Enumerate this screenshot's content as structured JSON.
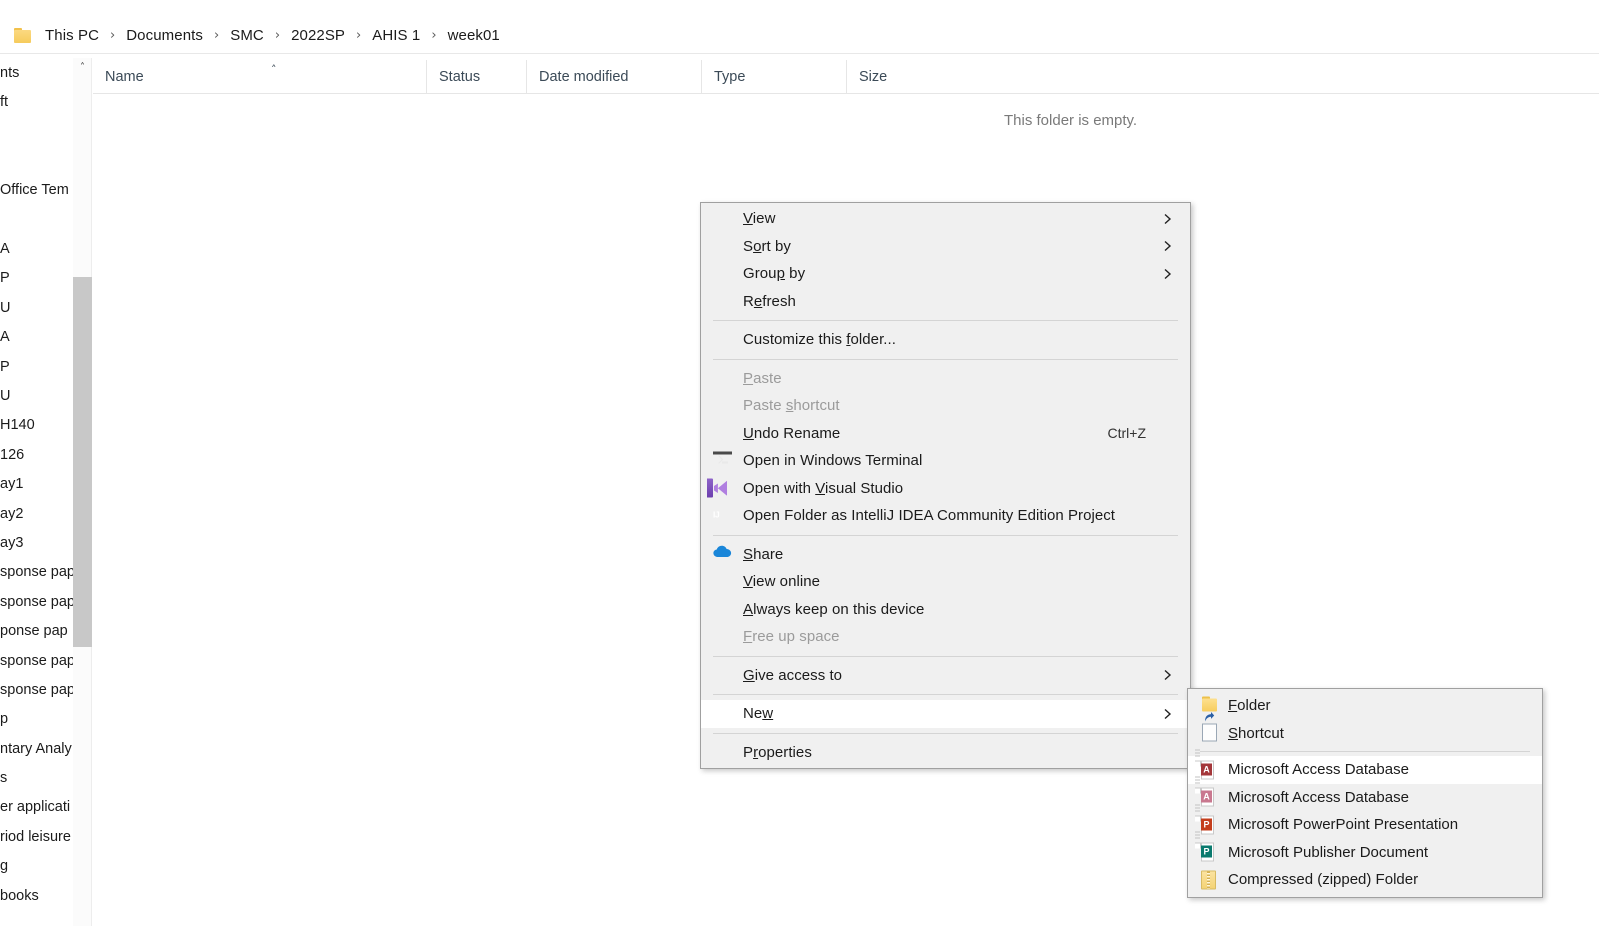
{
  "breadcrumb": {
    "folder_icon": "folder-icon",
    "separator": "›",
    "items": [
      {
        "label": "This PC"
      },
      {
        "label": "Documents"
      },
      {
        "label": "SMC"
      },
      {
        "label": "2022SP"
      },
      {
        "label": "AHIS 1"
      },
      {
        "label": "week01"
      }
    ]
  },
  "file_list": {
    "columns": [
      {
        "label": "Name"
      },
      {
        "label": "Status"
      },
      {
        "label": "Date modified"
      },
      {
        "label": "Type"
      },
      {
        "label": "Size"
      }
    ],
    "sort_caret": "˄",
    "empty_message": "This folder is empty."
  },
  "nav_pane": {
    "scroll_up_arrow": "˄",
    "items": [
      {
        "label": "nts"
      },
      {
        "label": "ft"
      },
      {
        "label": ""
      },
      {
        "label": ""
      },
      {
        "label": "Office Tem"
      },
      {
        "label": ""
      },
      {
        "label": "A"
      },
      {
        "label": "P"
      },
      {
        "label": "U"
      },
      {
        "label": "A"
      },
      {
        "label": "P"
      },
      {
        "label": "U"
      },
      {
        "label": "H140"
      },
      {
        "label": "126"
      },
      {
        "label": "ay1"
      },
      {
        "label": "ay2"
      },
      {
        "label": "ay3"
      },
      {
        "label": "sponse pap"
      },
      {
        "label": "sponse pap"
      },
      {
        "label": "ponse pap"
      },
      {
        "label": "sponse pap"
      },
      {
        "label": "sponse pap"
      },
      {
        "label": "p"
      },
      {
        "label": "ntary Analy"
      },
      {
        "label": "s"
      },
      {
        "label": "er applicati"
      },
      {
        "label": "riod leisure"
      },
      {
        "label": "g"
      },
      {
        "label": "books"
      }
    ]
  },
  "context_menu": {
    "items": [
      {
        "id": "view",
        "label": "View",
        "accel": "V",
        "accel_index": 0,
        "submenu": true,
        "icon": null,
        "shortcut": "",
        "disabled": false,
        "highlighted": false
      },
      {
        "id": "sort-by",
        "label": "Sort by",
        "accel": "o",
        "accel_index": 1,
        "submenu": true,
        "icon": null,
        "shortcut": "",
        "disabled": false,
        "highlighted": false
      },
      {
        "id": "group-by",
        "label": "Group by",
        "accel": "p",
        "accel_index": 4,
        "submenu": true,
        "icon": null,
        "shortcut": "",
        "disabled": false,
        "highlighted": false
      },
      {
        "id": "refresh",
        "label": "Refresh",
        "accel": "e",
        "accel_index": 1,
        "submenu": false,
        "icon": null,
        "shortcut": "",
        "disabled": false,
        "highlighted": false
      },
      {
        "id": "separator-1",
        "separator": true
      },
      {
        "id": "customize-this-folder",
        "label": "Customize this folder...",
        "accel": "f",
        "accel_index": 15,
        "submenu": false,
        "icon": null,
        "shortcut": "",
        "disabled": false,
        "highlighted": false
      },
      {
        "id": "separator-2",
        "separator": true
      },
      {
        "id": "paste",
        "label": "Paste",
        "accel": "P",
        "accel_index": 0,
        "submenu": false,
        "icon": null,
        "shortcut": "",
        "disabled": true,
        "highlighted": false
      },
      {
        "id": "paste-shortcut",
        "label": "Paste shortcut",
        "accel": "s",
        "accel_index": 6,
        "submenu": false,
        "icon": null,
        "shortcut": "",
        "disabled": true,
        "highlighted": false
      },
      {
        "id": "undo-rename",
        "label": "Undo Rename",
        "accel": "U",
        "accel_index": 0,
        "submenu": false,
        "icon": null,
        "shortcut": "Ctrl+Z",
        "disabled": false,
        "highlighted": false
      },
      {
        "id": "open-in-windows-terminal",
        "label": "Open in Windows Terminal",
        "accel": "",
        "accel_index": -1,
        "submenu": false,
        "icon": "terminal-icon",
        "shortcut": "",
        "disabled": false,
        "highlighted": false
      },
      {
        "id": "open-with-visual-studio",
        "label": "Open with Visual Studio",
        "accel": "V",
        "accel_index": 10,
        "submenu": false,
        "icon": "visual-studio-icon",
        "shortcut": "",
        "disabled": false,
        "highlighted": false
      },
      {
        "id": "open-folder-as-intellij-idea-community-edition-project",
        "label": "Open Folder as IntelliJ IDEA Community Edition Project",
        "accel": "",
        "accel_index": -1,
        "submenu": false,
        "icon": "intellij-idea-icon",
        "shortcut": "",
        "disabled": false,
        "highlighted": false
      },
      {
        "id": "separator-3",
        "separator": true
      },
      {
        "id": "share",
        "label": "Share",
        "accel": "S",
        "accel_index": 0,
        "submenu": false,
        "icon": "onedrive-cloud-icon",
        "shortcut": "",
        "disabled": false,
        "highlighted": false
      },
      {
        "id": "view-online",
        "label": "View online",
        "accel": "V",
        "accel_index": 0,
        "submenu": false,
        "icon": null,
        "shortcut": "",
        "disabled": false,
        "highlighted": false
      },
      {
        "id": "always-keep-on-this-device",
        "label": "Always keep on this device",
        "accel": "A",
        "accel_index": 0,
        "submenu": false,
        "icon": null,
        "shortcut": "",
        "disabled": false,
        "highlighted": false
      },
      {
        "id": "free-up-space",
        "label": "Free up space",
        "accel": "F",
        "accel_index": 0,
        "submenu": false,
        "icon": null,
        "shortcut": "",
        "disabled": true,
        "highlighted": false
      },
      {
        "id": "separator-4",
        "separator": true
      },
      {
        "id": "give-access-to",
        "label": "Give access to",
        "accel": "G",
        "accel_index": 0,
        "submenu": true,
        "icon": null,
        "shortcut": "",
        "disabled": false,
        "highlighted": false
      },
      {
        "id": "separator-5",
        "separator": true
      },
      {
        "id": "new",
        "label": "New",
        "accel": "w",
        "accel_index": 2,
        "submenu": true,
        "icon": null,
        "shortcut": "",
        "disabled": false,
        "highlighted": true
      },
      {
        "id": "separator-6",
        "separator": true
      },
      {
        "id": "properties",
        "label": "Properties",
        "accel": "r",
        "accel_index": 1,
        "submenu": false,
        "icon": null,
        "shortcut": "",
        "disabled": false,
        "highlighted": false
      }
    ]
  },
  "new_submenu": {
    "items": [
      {
        "id": "folder",
        "label": "Folder",
        "accel": "F",
        "accel_index": 0,
        "icon": "folder-icon",
        "icon_color": "#f7cd5e",
        "badge": "",
        "highlighted": false
      },
      {
        "id": "shortcut",
        "label": "Shortcut",
        "accel": "S",
        "accel_index": 0,
        "icon": "shortcut-icon",
        "icon_color": "#2a5fa5",
        "badge": "",
        "highlighted": false
      },
      {
        "id": "separator-1",
        "separator": true
      },
      {
        "id": "microsoft-access-database-1",
        "label": "Microsoft Access Database",
        "accel": "",
        "accel_index": -1,
        "icon": "access-database-icon",
        "icon_color": "#a4373a",
        "badge": "A",
        "highlighted": true
      },
      {
        "id": "microsoft-access-database-2",
        "label": "Microsoft Access Database",
        "accel": "",
        "accel_index": -1,
        "icon": "access-database-icon",
        "icon_color": "#c9788f",
        "badge": "A",
        "highlighted": false
      },
      {
        "id": "microsoft-powerpoint-presentation",
        "label": "Microsoft PowerPoint Presentation",
        "accel": "",
        "accel_index": -1,
        "icon": "powerpoint-icon",
        "icon_color": "#c43e1c",
        "badge": "P",
        "highlighted": false
      },
      {
        "id": "microsoft-publisher-document",
        "label": "Microsoft Publisher Document",
        "accel": "",
        "accel_index": -1,
        "icon": "publisher-icon",
        "icon_color": "#0a7a6e",
        "badge": "P",
        "highlighted": false
      },
      {
        "id": "compressed-zipped-folder",
        "label": "Compressed (zipped) Folder",
        "accel": "",
        "accel_index": -1,
        "icon": "zip-folder-icon",
        "icon_color": "#f4d375",
        "badge": "",
        "highlighted": false
      }
    ]
  },
  "colors": {
    "menu_background": "#f0f0f0",
    "menu_border": "#a0a0a0",
    "highlight": "#ffffff",
    "text": "#1b1b1b",
    "disabled_text": "#9b9b9b",
    "header_text": "#3b4a57",
    "empty_text": "#7a7a7a",
    "scrollbar_thumb": "#c8c8c8",
    "onedrive_blue": "#1a86d9"
  }
}
